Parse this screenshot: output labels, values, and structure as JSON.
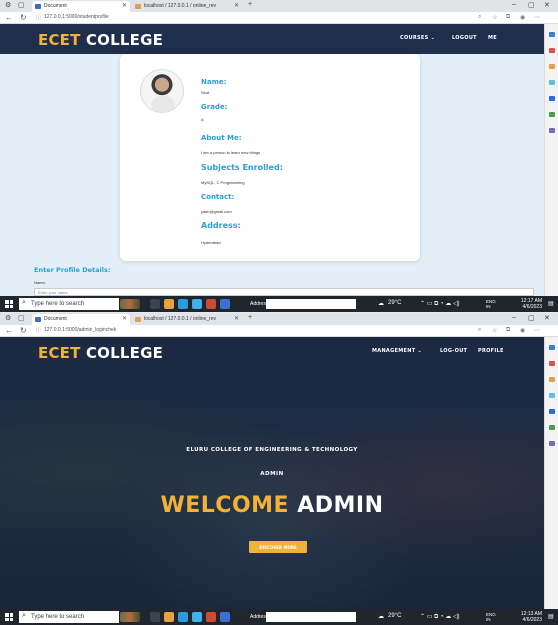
{
  "top": {
    "tabs": [
      {
        "label": "Document",
        "icon": "page-icon"
      },
      {
        "label": "localhost / 127.0.0.1 / online_rev",
        "icon": "phpmyadmin-icon"
      }
    ],
    "url": "127.0.0.1:5000/studentprofile",
    "brand_main": "ECET",
    "brand_rest": " COLLEGE",
    "nav": {
      "courses": "COURSES ⌄",
      "logout": "LOGOUT",
      "me": "ME"
    },
    "profile": {
      "name_label": "Name:",
      "name_value": "Sirut",
      "grade_label": "Grade:",
      "grade_value": "A",
      "about_label": "About Me:",
      "about_value": "I am a person to learn new things",
      "subjects_label": "Subjects Enrolled:",
      "subjects_value": "MySQL, C Programming",
      "contact_label": "Contact:",
      "contact_value": "yash@gmail.com",
      "address_label": "Address:",
      "address_value": "Hyderabad"
    },
    "form": {
      "title": "Enter Profile Details:",
      "name_label": "Name:",
      "name_placeholder": "Enter your name"
    },
    "taskbar": {
      "search": "Type here to search",
      "address_label": "Address",
      "weather": "29°C",
      "lang": "ENG",
      "lang2": "IN",
      "time": "12:17 AM",
      "date": "4/6/2023"
    }
  },
  "bottom": {
    "tabs": [
      {
        "label": "Document",
        "icon": "globe-icon"
      },
      {
        "label": "localhost / 127.0.0.1 / online_rev",
        "icon": "phpmyadmin-icon"
      }
    ],
    "url": "127.0.0.1:5000/admin_loginchek",
    "brand_main": "ECET",
    "brand_rest": " COLLEGE",
    "nav": {
      "management": "MANAGEMENT ⌄",
      "logout": "LOG-OUT",
      "profile": "PROFILE"
    },
    "hero": {
      "college": "ELURU COLLEGE OF ENGINEERING & TECHNOLOGY",
      "role": "ADMIN",
      "welcome_accent": "WELCOME",
      "welcome_rest": " ADMIN",
      "button": "DISCOVER MORE"
    },
    "taskbar": {
      "search": "Type here to search",
      "address_label": "Address",
      "weather": "29°C",
      "lang": "ENG",
      "lang2": "IN",
      "time": "12:13 AM",
      "date": "4/6/2023"
    }
  },
  "colors": {
    "navy": "#1f2e4c",
    "accent": "#f1b239",
    "label_blue": "#2a9fd6",
    "page_bg": "#e4eef6"
  }
}
